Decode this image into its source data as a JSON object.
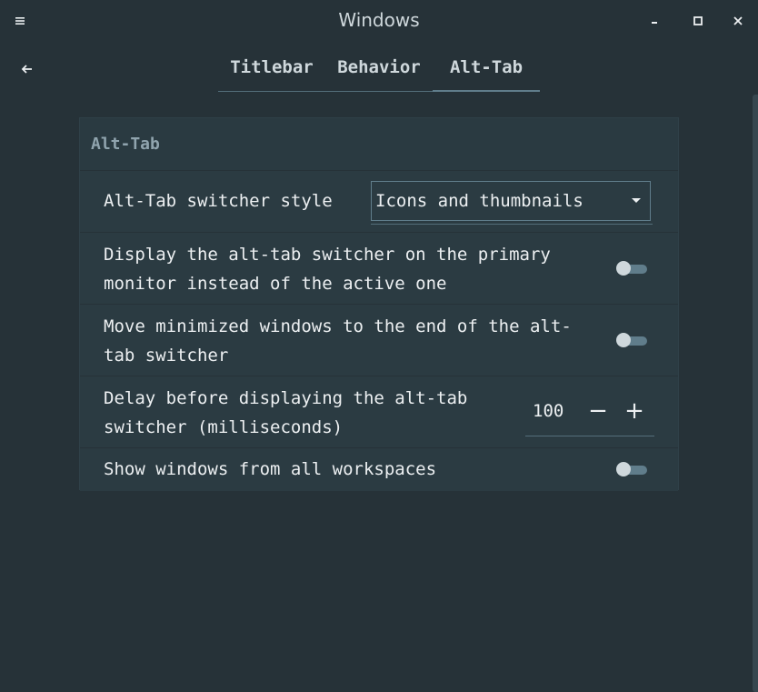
{
  "window": {
    "title": "Windows"
  },
  "icons": {
    "menu": "hamburger-icon",
    "minimize": "minimize-icon",
    "maximize": "maximize-icon",
    "close": "close-icon",
    "back": "back-arrow-icon",
    "dropdown": "caret-down-icon"
  },
  "tabs": [
    {
      "label": "Titlebar",
      "active": false
    },
    {
      "label": "Behavior",
      "active": false
    },
    {
      "label": "Alt-Tab",
      "active": true
    }
  ],
  "section": {
    "title": "Alt-Tab",
    "rows": [
      {
        "label": "Alt-Tab switcher style",
        "control": "dropdown",
        "value": "Icons and thumbnails"
      },
      {
        "label": "Display the alt-tab switcher on the primary\nmonitor instead of the active one",
        "control": "switch",
        "on": false
      },
      {
        "label": "Move minimized windows to the end of the alt-\ntab switcher",
        "control": "switch",
        "on": false
      },
      {
        "label": "Delay before displaying the alt-tab\nswitcher (milliseconds)",
        "control": "spinbutton",
        "value": "100",
        "decrement": "−",
        "increment": "+"
      },
      {
        "label": "Show windows from all workspaces",
        "control": "switch",
        "on": false
      }
    ]
  },
  "colors": {
    "background": "#263238",
    "panel": "#2b3b42",
    "text": "#eceff1",
    "muted": "#90a4ae",
    "accent": "#607d8b"
  }
}
